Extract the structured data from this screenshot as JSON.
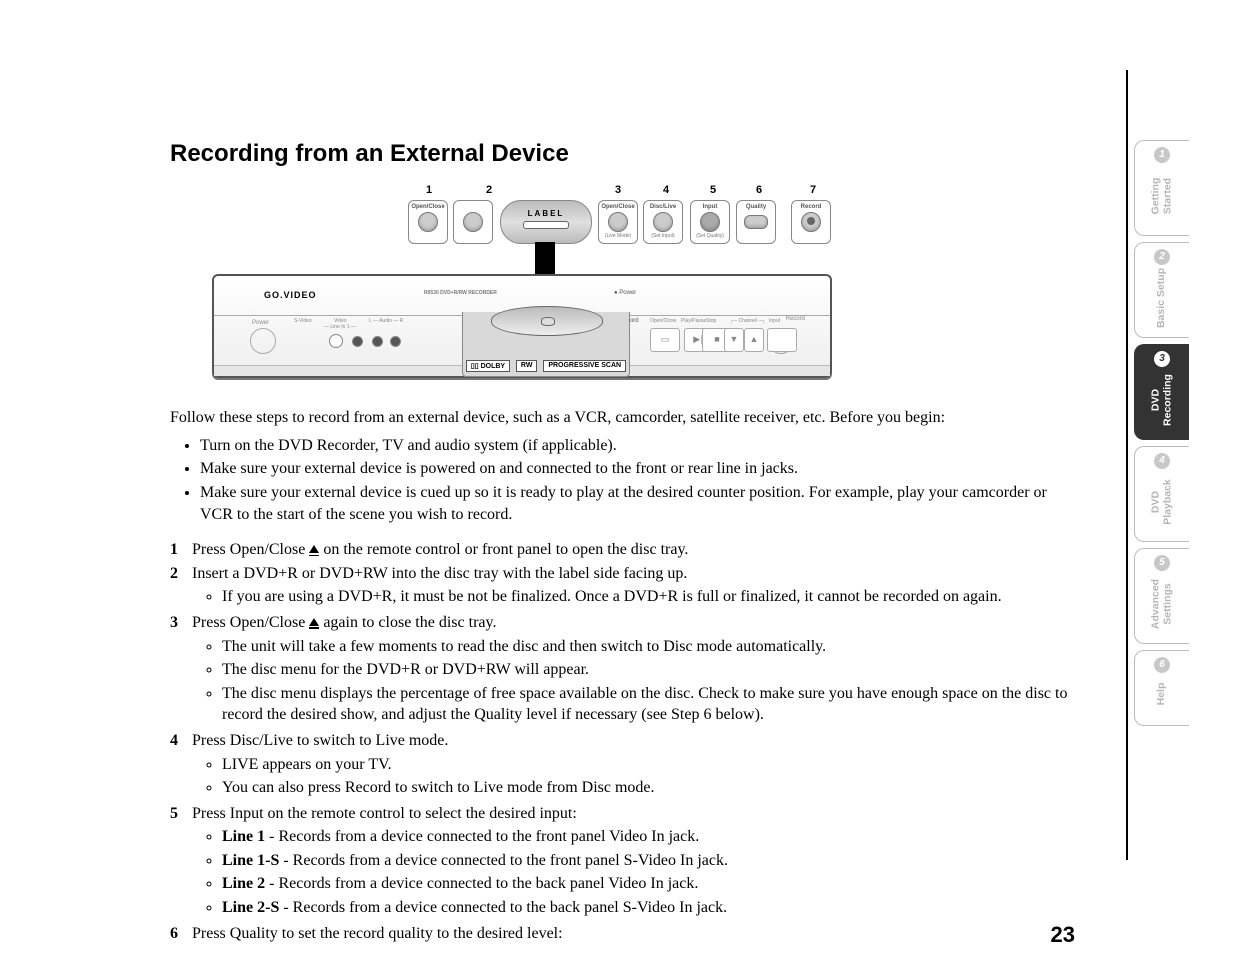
{
  "title": "Recording from an External Device",
  "page_number": "23",
  "diagram": {
    "numbers": [
      "1",
      "2",
      "3",
      "4",
      "5",
      "6",
      "7"
    ],
    "remote_buttons": {
      "b1": "Open/Close",
      "b3": "Open/Close",
      "b3_sub": "(Live Mode)",
      "b4": "Disc/Live",
      "b4_sub": "(Set Input)",
      "b5": "Input",
      "b5_sub": "(Set Quality)",
      "b6": "Quality",
      "b7": "Record"
    },
    "label_disc": "LABEL",
    "device": {
      "brand": "GO.VIDEO",
      "model": "R6530 DVD+R/RW RECORDER",
      "power": "● Power",
      "record": "● Record",
      "left_label": "Power",
      "right_label": "Record",
      "line_in": "— Line In 1 —",
      "jacks": {
        "svideo": "S-Video",
        "video": "Video",
        "audio": "L — Audio — R"
      },
      "ctl": {
        "openclose": "Open/Close",
        "playpause": "Play/Pause",
        "stop": "Stop",
        "channel": "┌─ Channel ─┐",
        "input": "Input"
      },
      "tray_logos": [
        "▯▯ DOLBY",
        "RW",
        "PROGRESSIVE SCAN"
      ]
    }
  },
  "intro": "Follow these steps to record from an external device, such as a VCR, camcorder, satellite receiver, etc. Before you begin:",
  "prechecks": [
    "Turn on the DVD Recorder, TV and audio system (if applicable).",
    "Make sure your external device is powered on and connected to the front or rear line in jacks.",
    "Make sure your external device is cued up so it is ready to play at the desired counter position. For example, play your camcorder or VCR to the start of the scene you wish to record."
  ],
  "steps": {
    "s1a": "Press Open/Close ",
    "s1b": " on the remote control or front panel to open the disc tray.",
    "s2": "Insert a DVD+R or DVD+RW into the disc tray with the label side facing up.",
    "s2_sub1": "If you are using a DVD+R, it must be not be finalized. Once a DVD+R is full or finalized, it cannot be recorded on again.",
    "s3a": "Press Open/Close ",
    "s3b": " again to close the disc tray.",
    "s3_sub1": "The unit will take a few moments to read the disc and then switch to Disc mode automatically.",
    "s3_sub2": "The disc menu for the DVD+R or DVD+RW will appear.",
    "s3_sub3": "The disc menu displays the percentage of free space available on the disc. Check to make sure you have enough space on the disc to record the desired show, and adjust the Quality level if necessary (see Step 6 below).",
    "s4": "Press Disc/Live to switch to Live mode.",
    "s4_sub1": "LIVE appears on your TV.",
    "s4_sub2": "You can also press Record to switch to Live mode from Disc mode.",
    "s5": "Press Input on the remote control to select the desired input:",
    "s5_l1b": "Line 1",
    "s5_l1t": " - Records from a device connected to the front panel Video In jack.",
    "s5_l2b": "Line 1-S",
    "s5_l2t": " - Records from a device connected to the front panel S-Video In jack.",
    "s5_l3b": "Line 2",
    "s5_l3t": " - Records from a device connected to the back panel Video In jack.",
    "s5_l4b": "Line 2-S",
    "s5_l4t": " - Records from a device connected to the back panel S-Video In jack.",
    "s6": "Press Quality to set the record quality to the desired level:"
  },
  "tabs": [
    {
      "num": "1",
      "label": "Getting\nStarted",
      "active": false
    },
    {
      "num": "2",
      "label": "Basic Setup",
      "active": false
    },
    {
      "num": "3",
      "label": "DVD\nRecording",
      "active": true
    },
    {
      "num": "4",
      "label": "DVD\nPlayback",
      "active": false
    },
    {
      "num": "5",
      "label": "Advanced\nSettings",
      "active": false
    },
    {
      "num": "6",
      "label": "Help",
      "active": false,
      "short": true
    }
  ]
}
